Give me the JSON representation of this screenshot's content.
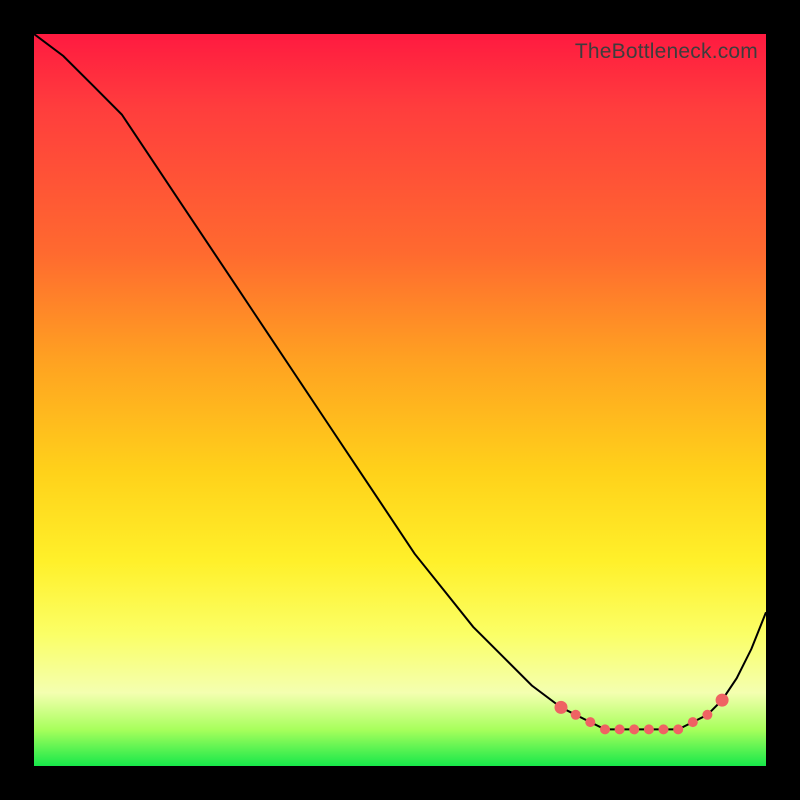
{
  "attribution": "TheBottleneck.com",
  "colors": {
    "frame": "#000000",
    "marker": "#ef6363",
    "curve": "#000000",
    "gradient_stops": [
      "#ff1a40",
      "#ff3d3d",
      "#ff6a2f",
      "#ffa321",
      "#ffd21a",
      "#fff02a",
      "#fbff66",
      "#f4ffb0",
      "#a8ff5c",
      "#17e84a"
    ]
  },
  "chart_data": {
    "type": "line",
    "title": "",
    "xlabel": "",
    "ylabel": "",
    "xlim": [
      0,
      100
    ],
    "ylim": [
      0,
      100
    ],
    "grid": false,
    "legend": false,
    "series": [
      {
        "name": "bottleneck-curve",
        "x": [
          0,
          4,
          8,
          12,
          16,
          20,
          24,
          28,
          32,
          36,
          40,
          44,
          48,
          52,
          56,
          60,
          64,
          68,
          72,
          74,
          76,
          78,
          80,
          82,
          84,
          86,
          88,
          90,
          92,
          94,
          96,
          98,
          100
        ],
        "y": [
          100,
          97,
          93,
          89,
          83,
          77,
          71,
          65,
          59,
          53,
          47,
          41,
          35,
          29,
          24,
          19,
          15,
          11,
          8,
          7,
          6,
          5,
          5,
          5,
          5,
          5,
          5,
          6,
          7,
          9,
          12,
          16,
          21
        ]
      }
    ],
    "markers": {
      "name": "highlight-flat-region",
      "x": [
        72,
        74,
        76,
        78,
        80,
        82,
        84,
        86,
        88,
        90,
        92,
        94
      ],
      "y": [
        8,
        7,
        6,
        5,
        5,
        5,
        5,
        5,
        5,
        6,
        7,
        9
      ]
    }
  }
}
